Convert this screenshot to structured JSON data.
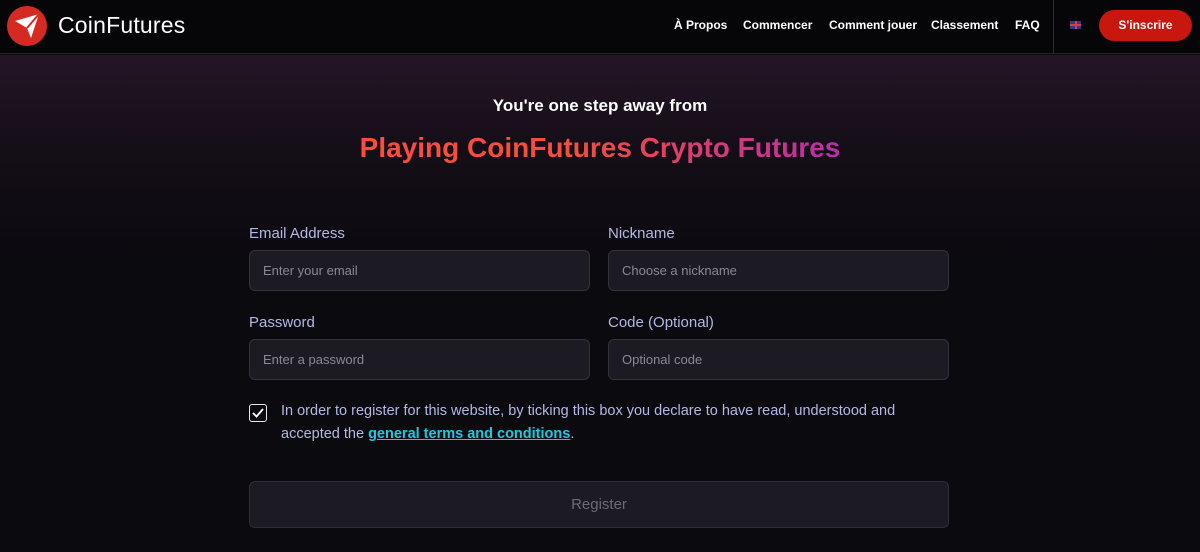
{
  "header": {
    "brand": "CoinFutures",
    "nav": [
      "À Propos",
      "Commencer",
      "Comment jouer",
      "Classement",
      "FAQ"
    ],
    "signup_label": "S'inscrire",
    "accent_color": "#c8170f"
  },
  "hero": {
    "subtitle": "You're one step away from",
    "title": "Playing CoinFutures Crypto Futures"
  },
  "form": {
    "email": {
      "label": "Email Address",
      "placeholder": "Enter your email",
      "value": ""
    },
    "nickname": {
      "label": "Nickname",
      "placeholder": "Choose a nickname",
      "value": ""
    },
    "password": {
      "label": "Password",
      "placeholder": "Enter a password",
      "value": ""
    },
    "code": {
      "label": "Code (Optional)",
      "placeholder": "Optional code",
      "value": ""
    },
    "terms": {
      "checked": true,
      "text_before": "In order to register for this website, by ticking this box you declare to have read, understood and accepted the ",
      "link_text": "general terms and conditions",
      "text_after": "."
    },
    "register_label": "Register"
  }
}
